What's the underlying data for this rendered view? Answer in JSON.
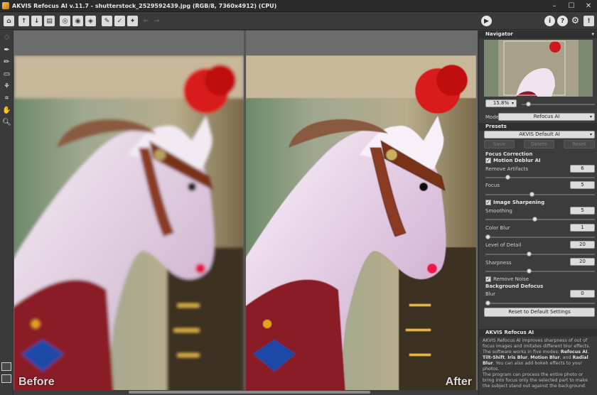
{
  "titlebar": {
    "title": "AKVIS Refocus AI v.11.7 - shutterstock_2529592439.jpg (RGB/8, 7360x4912) (CPU)",
    "minimize": "–",
    "maximize": "☐",
    "close": "✕"
  },
  "toolbar": {
    "icons": [
      "home-icon",
      "open-file-icon",
      "save-file-icon",
      "print-icon",
      "batch-icon",
      "share-icon",
      "plugin-icon",
      "preset-brush-icon",
      "brush-icon",
      "brush-options-icon",
      "undo-icon",
      "redo-icon"
    ],
    "run": "▶",
    "info": "i",
    "help": "?",
    "settings": "⚙",
    "notes": "!"
  },
  "canvas": {
    "before_label": "Before",
    "after_label": "After"
  },
  "navigator": {
    "title": "Navigator",
    "zoom": "15.8%",
    "zoom_level": 0.06
  },
  "settings": {
    "mode_label": "Mode:",
    "mode_value": "Refocus AI",
    "presets_title": "Presets",
    "preset_value": "AKVIS Default AI",
    "save_label": "Save",
    "delete_label": "Delete",
    "reset_label": "Reset",
    "focus_correction": "Focus Correction",
    "motion_deblur": "Motion Deblur AI",
    "remove_artifacts_label": "Remove Artifacts",
    "remove_artifacts_value": "6",
    "focus_label": "Focus",
    "focus_value": "5",
    "image_sharpening": "Image Sharpening",
    "smoothing_label": "Smoothing",
    "smoothing_value": "5",
    "color_blur_label": "Color Blur",
    "color_blur_value": "1",
    "level_detail_label": "Level of Detail",
    "level_detail_value": "20",
    "sharpness_label": "Sharpness",
    "sharpness_value": "20",
    "remove_noise": "Remove Noise",
    "background_defocus": "Background Defocus",
    "blur_label": "Blur",
    "blur_value": "0",
    "reset_default": "Reset to Default Settings",
    "check": "✓"
  },
  "help": {
    "title": "AKVIS Refocus AI",
    "p1_start": "AKVIS Refocus AI improves sharpness of out of focus images and imitates different blur effects. The software works in five modes: ",
    "m1": "Refocus AI",
    "m2": "Tilt-Shift",
    "m3": "Iris Blur",
    "m4": "Motion Blur",
    "m5": "Radial Blur",
    "sep": ", ",
    "and": ", and ",
    "p1_end": ". You can also add bokeh effects to your photos.",
    "p2": "The program can process the entire photo or bring into focus only the selected part to make the subject stand out against the background."
  }
}
